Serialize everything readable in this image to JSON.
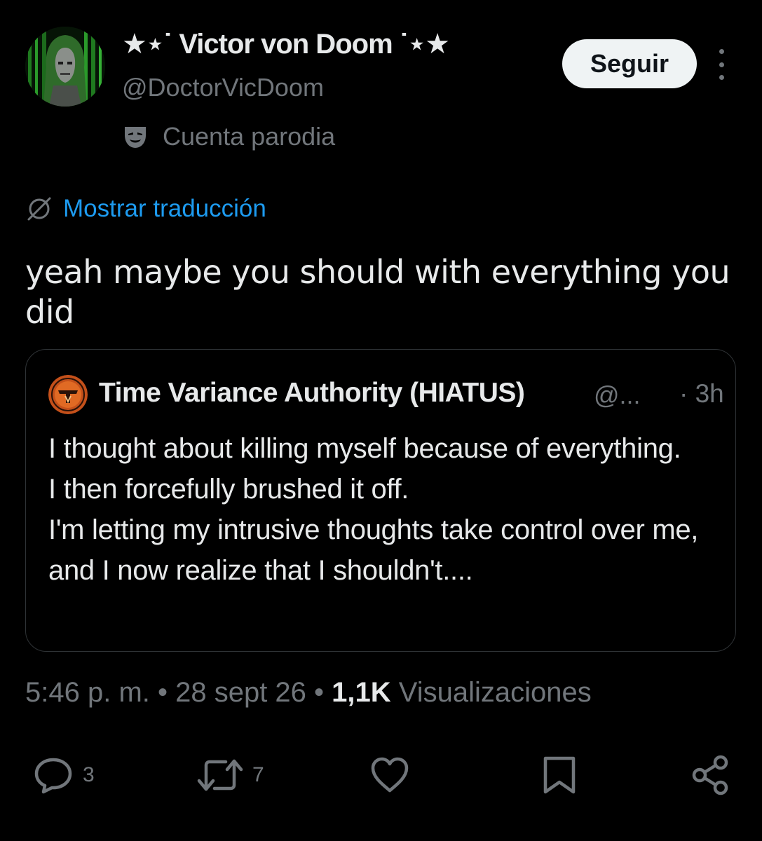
{
  "author": {
    "display_name": "★⋆˙ Victor von Doom ˙⋆★",
    "handle": "@DoctorVicDoom",
    "parody_label": "Cuenta parodia"
  },
  "follow_label": "Seguir",
  "translate_label": "Mostrar traducción",
  "tweet_text": "yeah maybe you should with everything you did",
  "quoted": {
    "name": "Time Variance Authority (HIATUS)",
    "handle": "@...",
    "time": "· 3h",
    "text": "I thought about killing myself because of everything.\nI then forcefully brushed it off.\nI'm letting my intrusive thoughts take control over me, and I now realize that I shouldn't...."
  },
  "meta": {
    "time": "5:46 p. m.",
    "sep1": " • ",
    "date": "28 sept 26",
    "sep2": " • ",
    "views_count": "1,1K",
    "views_label": " Visualizaciones"
  },
  "actions": {
    "replies": "3",
    "reposts": "7"
  },
  "colors": {
    "background": "#000000",
    "text": "#e7e9ea",
    "secondary": "#71767b",
    "link": "#1d9bf0",
    "border": "#2f3336",
    "follow_bg": "#eff3f4"
  },
  "icons": [
    "parody-mask-icon",
    "translate-globe-icon",
    "more-icon",
    "reply-icon",
    "repost-icon",
    "like-icon",
    "bookmark-icon",
    "share-icon"
  ]
}
